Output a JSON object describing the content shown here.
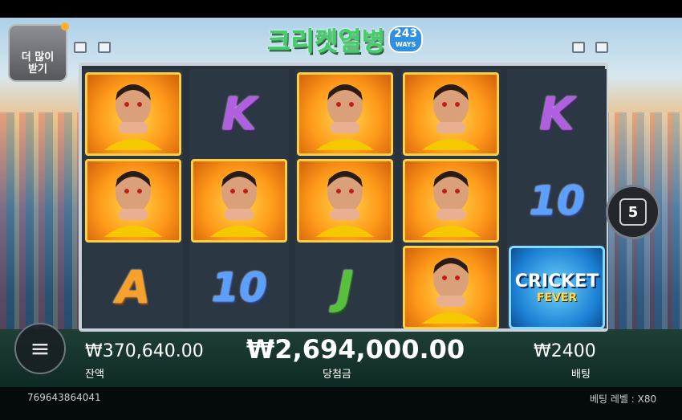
{
  "game": {
    "logo_text": "크리켓열병",
    "logo_badge_number": "243",
    "logo_badge_word": "WAYS"
  },
  "buttons": {
    "more_line1": "더 많이",
    "more_line2": "받기",
    "spin_value": "5",
    "menu_icon": "≡"
  },
  "reels": [
    [
      "player",
      "player",
      "A"
    ],
    [
      "K",
      "player",
      "10"
    ],
    [
      "player",
      "player",
      "J"
    ],
    [
      "player",
      "player",
      "player"
    ],
    [
      "K",
      "10",
      "cricket-fever"
    ]
  ],
  "scatter": {
    "title": "CRICKET",
    "subtitle": "FEVER"
  },
  "stats": {
    "balance_value": "₩370,640.00",
    "balance_label": "잔액",
    "win_value": "₩2,694,000.00",
    "win_label": "당첨금",
    "bet_value": "₩2400",
    "bet_label": "배팅"
  },
  "footer": {
    "id": "769643864041",
    "bet_level": "베팅 레벨 : X80"
  },
  "colors": {
    "frame": "#c9d2d8",
    "player_gold": "#ffcf4a",
    "win_text": "#ffffff"
  }
}
